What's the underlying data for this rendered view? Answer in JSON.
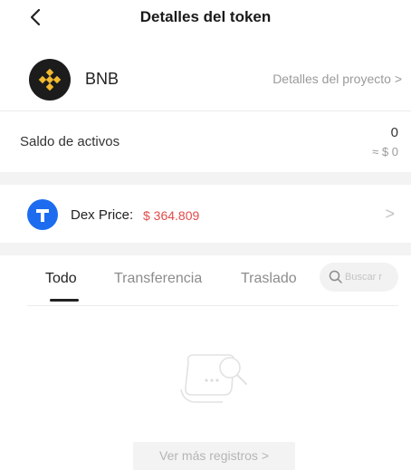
{
  "header": {
    "title": "Detalles del token",
    "back_icon": "chevron-left-icon"
  },
  "token": {
    "symbol": "BNB",
    "project_link": "Detalles del proyecto >",
    "logo_icon": "bnb-logo-icon"
  },
  "balance": {
    "label": "Saldo de activos",
    "amount": "0",
    "fiat": "≈ $ 0"
  },
  "dex": {
    "label": "Dex Price:",
    "price": "$ 364.809",
    "chevron": ">",
    "price_color": "#e24a4a"
  },
  "tabs": [
    {
      "label": "Todo",
      "active": true
    },
    {
      "label": "Transferencia",
      "active": false
    },
    {
      "label": "Traslado",
      "active": false
    }
  ],
  "search": {
    "placeholder": "Buscar r"
  },
  "empty_state": {
    "icon": "empty-records-icon"
  },
  "more_button": {
    "label": "Ver más registros >"
  },
  "colors": {
    "accent_blue": "#1d6cf0",
    "bnb_yellow": "#f3ba2f",
    "price_red": "#e24a4a"
  }
}
